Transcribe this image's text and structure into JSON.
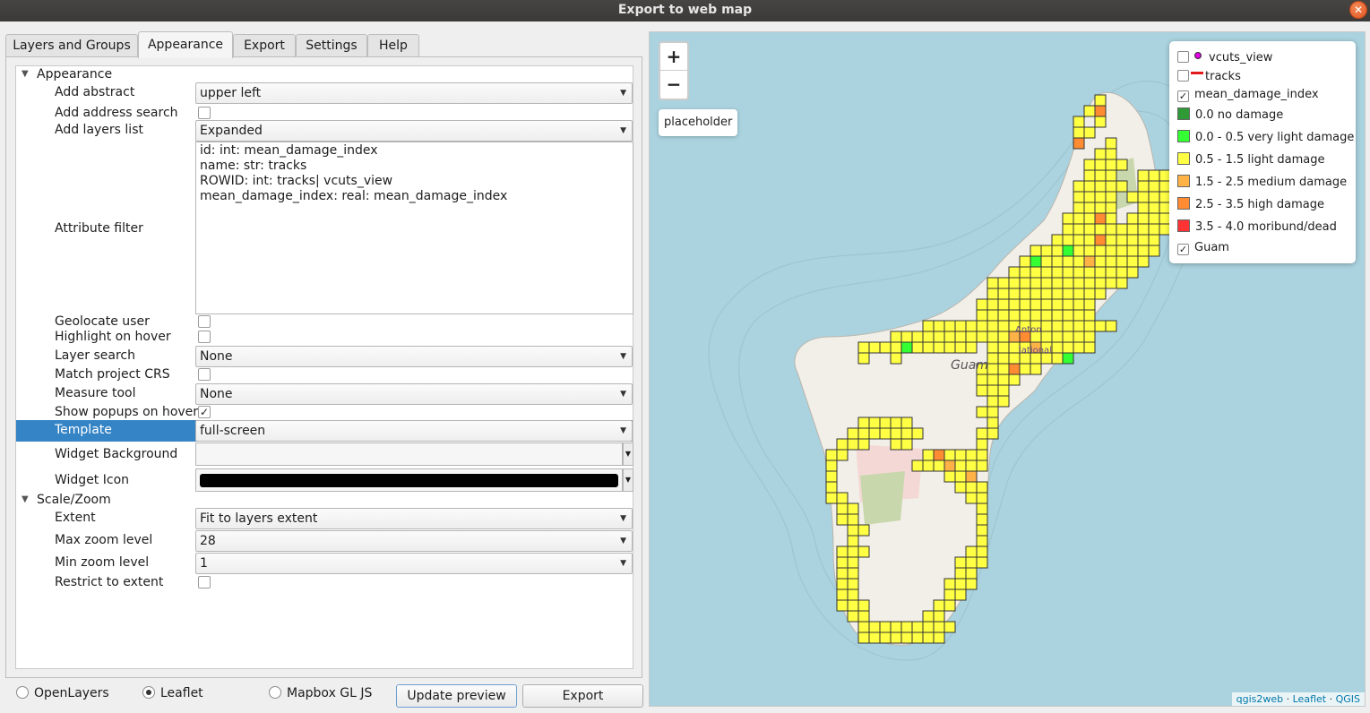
{
  "window": {
    "title": "Export to web map",
    "close_glyph": "✕"
  },
  "tabs": [
    "Layers and Groups",
    "Appearance",
    "Export",
    "Settings",
    "Help"
  ],
  "appearance": {
    "section_label": "Appearance",
    "add_abstract": {
      "label": "Add abstract",
      "value": "upper left"
    },
    "add_address_search": {
      "label": "Add address search",
      "checked": false
    },
    "add_layers_list": {
      "label": "Add layers list",
      "value": "Expanded"
    },
    "attribute_filter": {
      "label": "Attribute filter",
      "lines": [
        "id: int: mean_damage_index",
        "name: str: tracks",
        "ROWID: int: tracks| vcuts_view",
        "mean_damage_index: real: mean_damage_index"
      ]
    },
    "geolocate_user": {
      "label": "Geolocate user",
      "checked": false
    },
    "highlight_on_hover": {
      "label": "Highlight on hover",
      "checked": false
    },
    "layer_search": {
      "label": "Layer search",
      "value": "None"
    },
    "match_project_crs": {
      "label": "Match project CRS",
      "checked": false
    },
    "measure_tool": {
      "label": "Measure tool",
      "value": "None"
    },
    "show_popups_on_hover": {
      "label": "Show popups on hover",
      "checked": true,
      "check_glyph": "✓"
    },
    "template": {
      "label": "Template",
      "value": "full-screen"
    },
    "widget_background": {
      "label": "Widget Background",
      "color": "#f6f6f6"
    },
    "widget_icon": {
      "label": "Widget Icon",
      "color": "#000000"
    }
  },
  "scale_zoom": {
    "section_label": "Scale/Zoom",
    "extent": {
      "label": "Extent",
      "value": "Fit to layers extent"
    },
    "max_zoom": {
      "label": "Max zoom level",
      "value": "28"
    },
    "min_zoom": {
      "label": "Min zoom level",
      "value": "1"
    },
    "restrict_to_extent": {
      "label": "Restrict to extent",
      "checked": false
    }
  },
  "bottom": {
    "radios": [
      {
        "label": "OpenLayers",
        "selected": false
      },
      {
        "label": "Leaflet",
        "selected": true
      },
      {
        "label": "Mapbox GL JS",
        "selected": false
      }
    ],
    "update_preview": "Update preview",
    "export": "Export"
  },
  "map": {
    "zoom_in": "+",
    "zoom_out": "−",
    "placeholder": "placeholder",
    "legend": [
      {
        "label": "vcuts_view",
        "checkbox": true,
        "checked": false,
        "symbol": "point",
        "color": "#e000e0"
      },
      {
        "label": "tracks",
        "checkbox": true,
        "checked": false,
        "symbol": "line",
        "color": "#e31a1c"
      },
      {
        "label": "mean_damage_index",
        "checkbox": true,
        "checked": true
      },
      {
        "label": "0.0 no damage",
        "symbol": "square",
        "color": "#2e9b36"
      },
      {
        "label": "0.0 - 0.5 very light damage",
        "symbol": "square",
        "color": "#33ff33"
      },
      {
        "label": "0.5 - 1.5 light damage",
        "symbol": "square",
        "color": "#ffff44"
      },
      {
        "label": "1.5 - 2.5 medium damage",
        "symbol": "square",
        "color": "#ffb347"
      },
      {
        "label": "2.5 - 3.5 high damage",
        "symbol": "square",
        "color": "#ff8c33"
      },
      {
        "label": "3.5 - 4.0 moribund/dead",
        "symbol": "square",
        "color": "#ff3333"
      },
      {
        "label": "Guam",
        "checkbox": true,
        "checked": true
      }
    ],
    "attribution": [
      "qgis2web",
      "Leaflet",
      "QGIS"
    ],
    "labels": {
      "island": "Guam",
      "place1": "Anton",
      "place2": "lational"
    }
  },
  "icons": [
    "close-icon",
    "chevron-down-icon",
    "expand-arrow-icon",
    "zoom-in-icon",
    "zoom-out-icon"
  ],
  "colors": {
    "accent": "#3584c6",
    "water": "#aad3df",
    "land": "#f2efe9"
  }
}
